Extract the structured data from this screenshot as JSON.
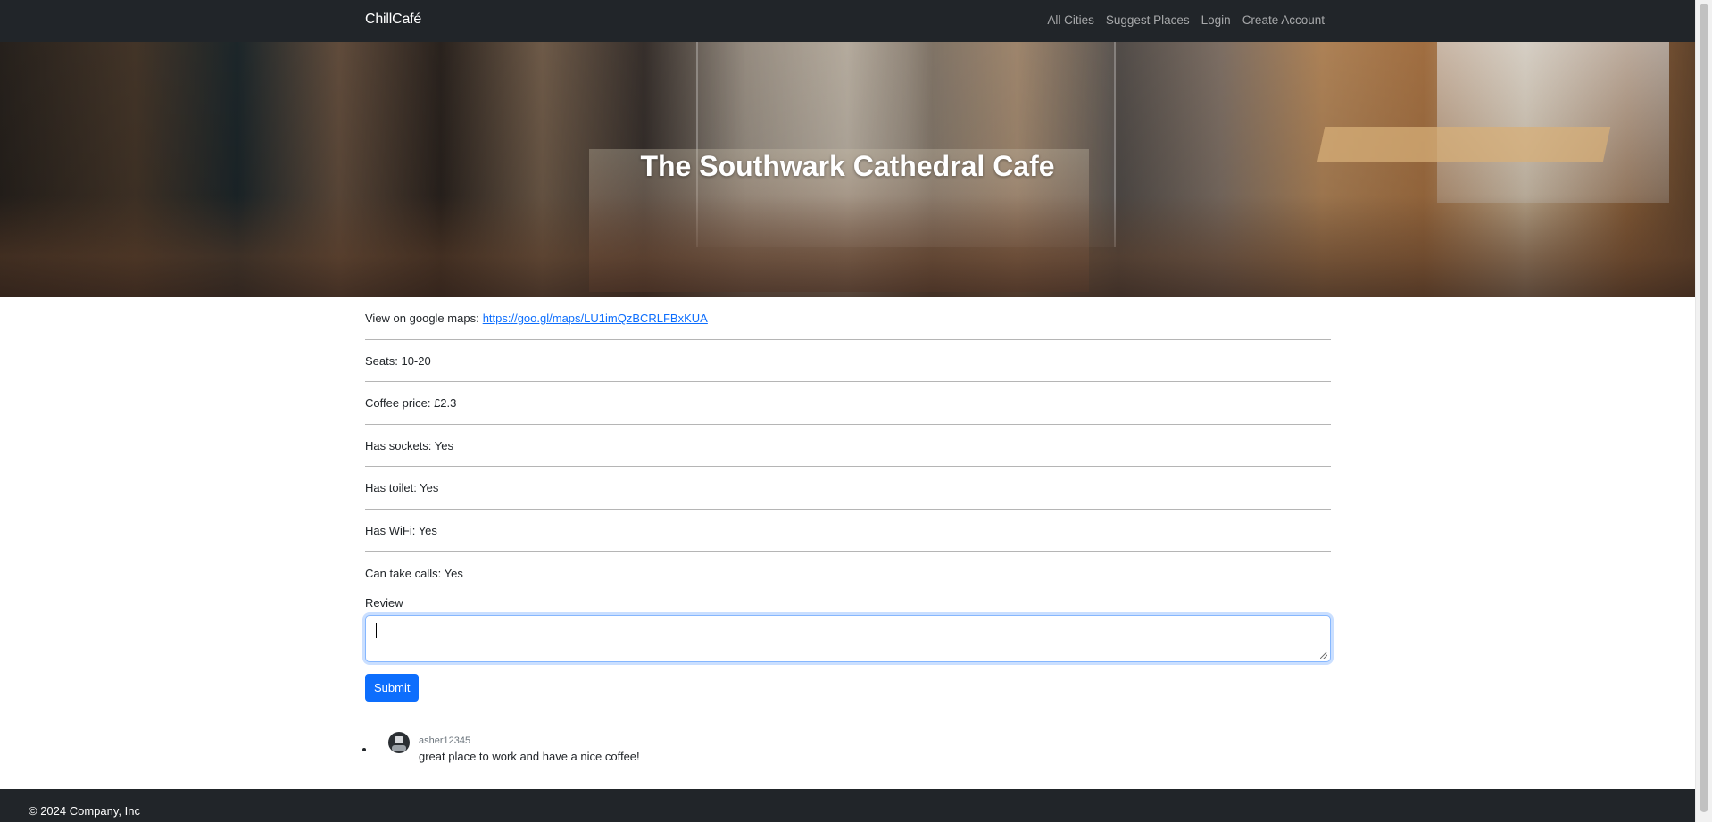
{
  "navbar": {
    "brand": "ChillCafé",
    "links": [
      "All Cities",
      "Suggest Places",
      "Login",
      "Create Account"
    ]
  },
  "hero": {
    "title": "The Southwark Cathedral Cafe"
  },
  "details": {
    "maps_label": "View on google maps:",
    "maps_url": "https://goo.gl/maps/LU1imQzBCRLFBxKUA",
    "seats": "Seats: 10-20",
    "coffee_price": "Coffee price: £2.3",
    "sockets": "Has sockets: Yes",
    "toilet": "Has toilet: Yes",
    "wifi": "Has WiFi: Yes",
    "calls": "Can take calls: Yes"
  },
  "review_form": {
    "label": "Review",
    "value": "",
    "submit_label": "Submit"
  },
  "reviews": [
    {
      "user": "asher12345",
      "text": "great place to work and have a nice coffee!"
    }
  ],
  "footer": {
    "text": "© 2024 Company, Inc"
  },
  "colors": {
    "navbar_bg": "#212529",
    "link_blue": "#0d6efd",
    "button_blue": "#0d6efd"
  }
}
